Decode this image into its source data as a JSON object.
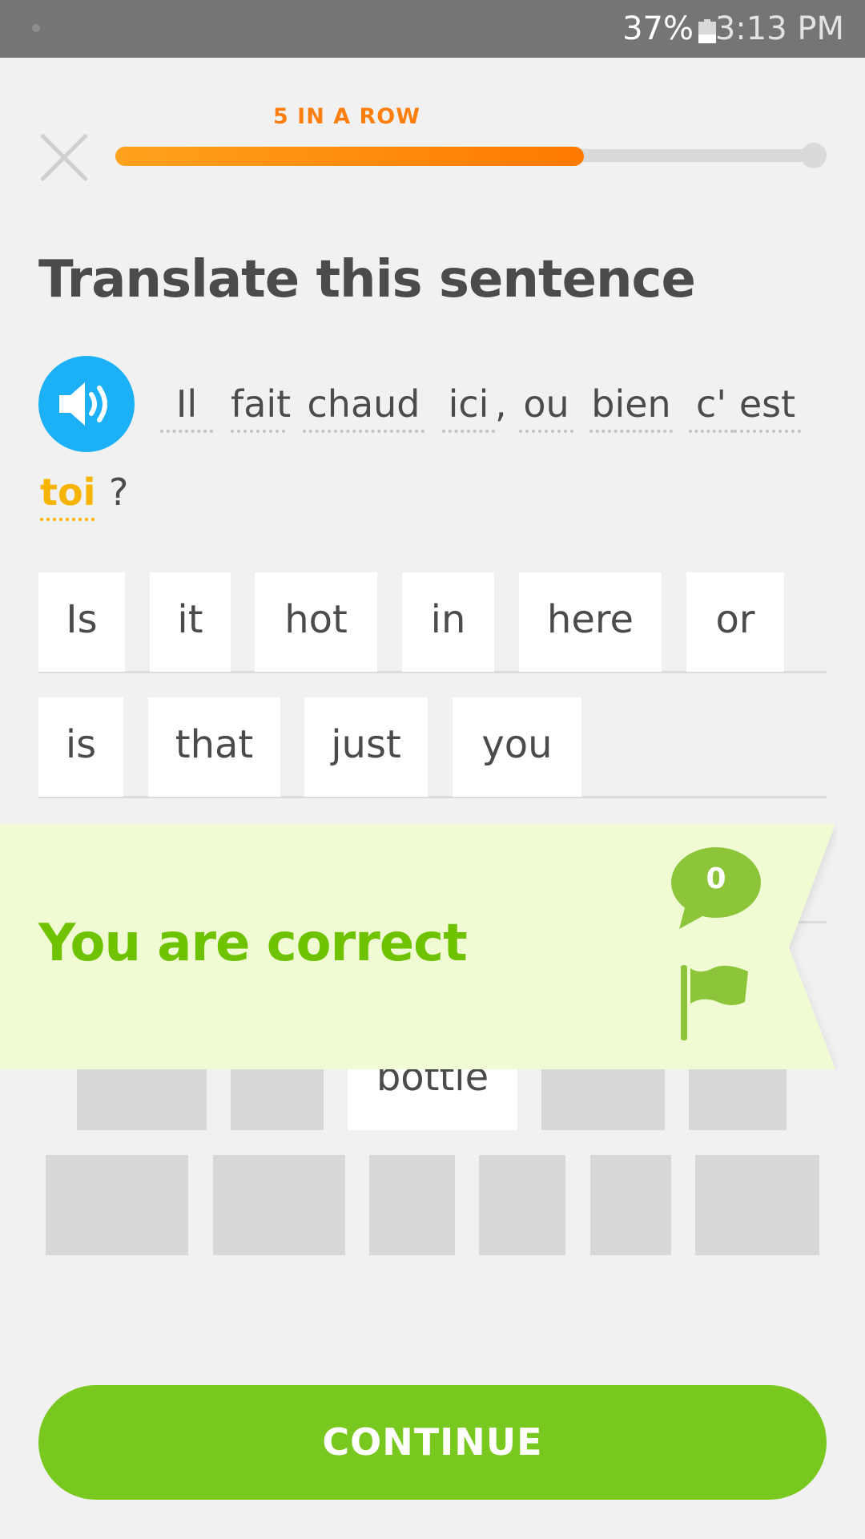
{
  "status_bar": {
    "battery_percent": "37%",
    "time": "3:13 PM",
    "battery_level": 0.37
  },
  "header": {
    "streak_label": "5 IN A ROW",
    "progress": 0.66,
    "close_icon": "close-icon"
  },
  "instruction": "Translate this sentence",
  "speaker_icon": "speaker-icon",
  "sentence": {
    "words": [
      "Il",
      "fait",
      "chaud",
      "ici",
      ",",
      "ou",
      "bien",
      "c'",
      "est",
      "toi",
      "?"
    ],
    "highlighted_word": "toi"
  },
  "answer_tiles": [
    "Is",
    "it",
    "hot",
    "in",
    "here",
    "or",
    "is",
    "that",
    "just",
    "you"
  ],
  "word_bank_visible": [
    "bottle"
  ],
  "feedback": {
    "message": "You are correct",
    "comment_count": "0",
    "comment_icon": "speech-bubble-icon",
    "flag_icon": "flag-icon"
  },
  "continue_label": "CONTINUE",
  "colors": {
    "accent_green": "#78c81f",
    "correct_text": "#6fc200",
    "banner_bg": "#f0fbd4",
    "streak_orange": "#ff7f0e",
    "speaker_blue": "#1cb0f6",
    "highlight_yellow": "#f6b400"
  }
}
